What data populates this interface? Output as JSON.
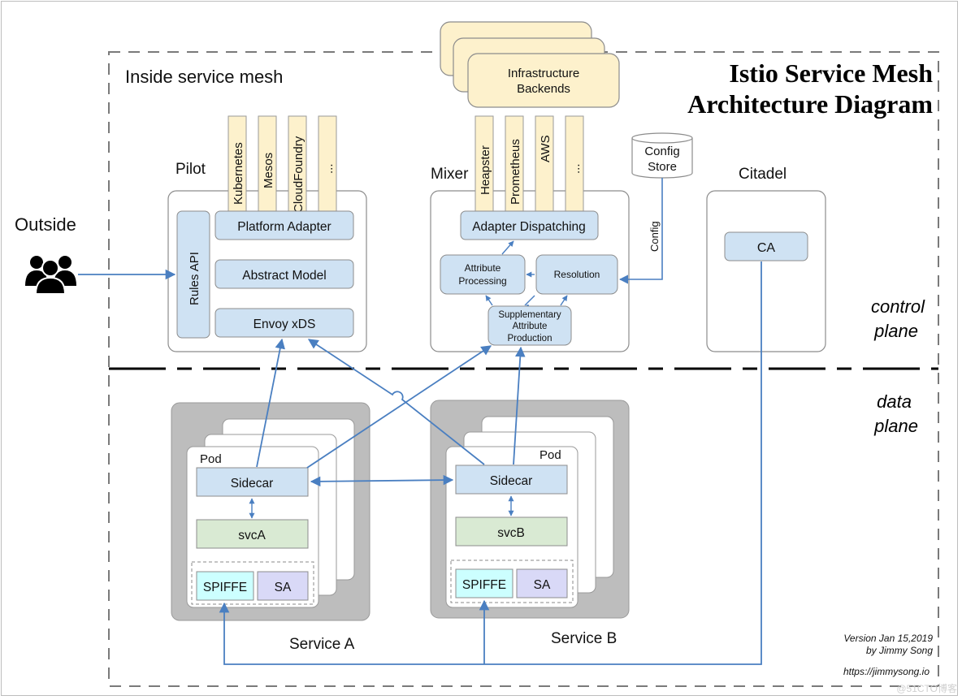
{
  "title": {
    "line1": "Istio Service Mesh",
    "line2": "Architecture Diagram"
  },
  "regions": {
    "inside_mesh": "Inside service mesh",
    "outside": "Outside",
    "control_plane_line1": "control",
    "control_plane_line2": "plane",
    "data_plane_line1": "data",
    "data_plane_line2": "plane"
  },
  "infrastructure": {
    "line1": "Infrastructure",
    "line2": "Backends"
  },
  "pilot": {
    "label": "Pilot",
    "platforms": [
      "Kubernetes",
      "Mesos",
      "CloudFoundry",
      "..."
    ],
    "rules_api": "Rules API",
    "platform_adapter": "Platform Adapter",
    "abstract_model": "Abstract Model",
    "envoy_xds": "Envoy xDS"
  },
  "mixer": {
    "label": "Mixer",
    "backends": [
      "Heapster",
      "Prometheus",
      "AWS",
      "..."
    ],
    "adapter_dispatching": "Adapter Dispatching",
    "attribute_processing_line1": "Attribute",
    "attribute_processing_line2": "Processing",
    "resolution": "Resolution",
    "supplementary_line1": "Supplementary",
    "supplementary_line2": "Attribute",
    "supplementary_line3": "Production"
  },
  "config_store": {
    "line1": "Config",
    "line2": "Store",
    "edge_label": "Config"
  },
  "citadel": {
    "label": "Citadel",
    "ca": "CA"
  },
  "service_a": {
    "label": "Service A",
    "pod": "Pod",
    "sidecar": "Sidecar",
    "svc": "svcA",
    "spiffe": "SPIFFE",
    "sa": "SA"
  },
  "service_b": {
    "label": "Service B",
    "pod": "Pod",
    "sidecar": "Sidecar",
    "svc": "svcB",
    "spiffe": "SPIFFE",
    "sa": "SA"
  },
  "footer": {
    "version": "Version Jan 15,2019",
    "author": "by Jimmy Song",
    "url": "https://jimmysong.io",
    "watermark": "@51CTO博客"
  },
  "colors": {
    "arrow": "#4a7fc1",
    "box_blue": "#cfe2f3",
    "box_yellow": "#fdf1cc",
    "box_green": "#d9ead3",
    "box_cyan": "#ccffff",
    "box_lavender": "#d9d9f7",
    "service_gray": "#bdbdbd"
  }
}
